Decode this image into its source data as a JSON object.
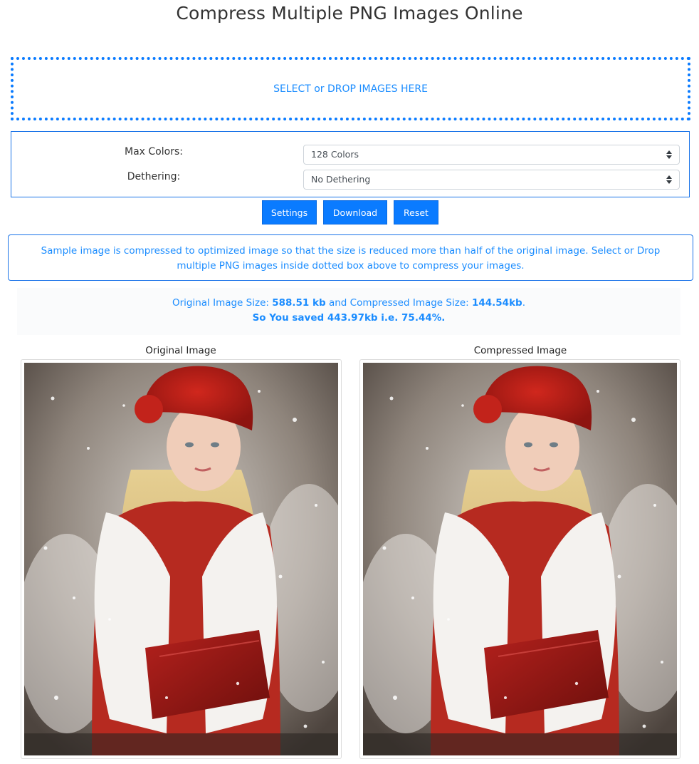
{
  "page": {
    "title": "Compress Multiple PNG Images Online"
  },
  "drop_zone": {
    "label": "SELECT or DROP IMAGES HERE"
  },
  "settings": {
    "max_colors_label": "Max Colors:",
    "max_colors_value": "128 Colors",
    "dithering_label": "Dethering:",
    "dithering_value": "No Dethering"
  },
  "buttons": {
    "settings": "Settings",
    "download": "Download",
    "reset": "Reset"
  },
  "info": {
    "text": "Sample image is compressed to optimized image so that the size is reduced more than half of the original image. Select or Drop multiple PNG images inside dotted box above to compress your images."
  },
  "stats": {
    "original_prefix": "Original Image Size: ",
    "original_size": "588.51 kb",
    "compressed_prefix": " and Compressed Image Size: ",
    "compressed_size": "144.54kb",
    "compressed_suffix": ".",
    "saved_text": "So You saved 443.97kb i.e. 75.44%."
  },
  "images": {
    "original_title": "Original Image",
    "compressed_title": "Compressed Image"
  },
  "colors": {
    "accent": "#0a7bff",
    "info_text": "#1a8cff"
  },
  "icons": {
    "select_caret": "updown-caret-icon"
  }
}
